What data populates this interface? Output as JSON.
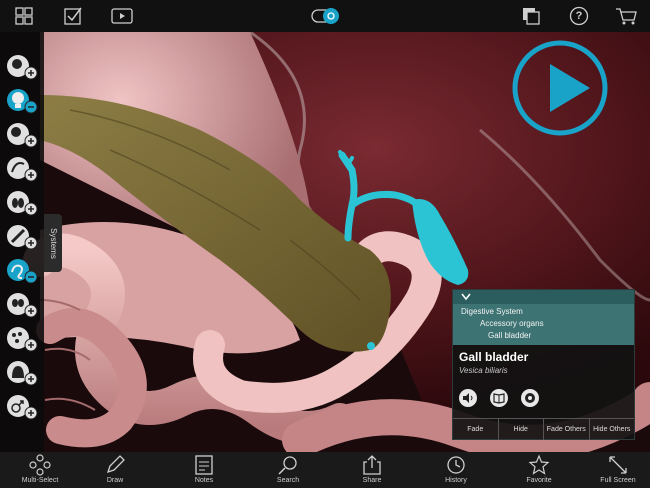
{
  "topbar": {
    "icons": [
      "grid-icon",
      "checklist-icon",
      "video-icon",
      "camera-toggle-icon",
      "layers-icon",
      "help-icon",
      "cart-icon"
    ],
    "help_label": "?"
  },
  "sidebar": {
    "tab_label": "Systems",
    "buttons": [
      "skeletal",
      "muscular",
      "cardiovascular",
      "nervous",
      "respiratory",
      "lymphatic",
      "digestive",
      "urinary",
      "endocrine",
      "integumentary",
      "reproductive"
    ],
    "active_index": 6
  },
  "info_panel": {
    "breadcrumbs": [
      "Digestive System",
      "Accessory organs",
      "Gall bladder"
    ],
    "title": "Gall bladder",
    "latin": "Vesica biliaris",
    "actions": [
      "Fade",
      "Hide",
      "Fade Others",
      "Hide Others"
    ],
    "icons": [
      "speaker-icon",
      "book-icon",
      "quiz-icon"
    ]
  },
  "bottombar": {
    "items": [
      {
        "label": "Multi-Select",
        "icon": "multi-select-icon"
      },
      {
        "label": "Draw",
        "icon": "pencil-icon"
      },
      {
        "label": "Notes",
        "icon": "notes-icon"
      },
      {
        "label": "Search",
        "icon": "search-icon"
      },
      {
        "label": "Share",
        "icon": "share-icon"
      },
      {
        "label": "History",
        "icon": "history-icon"
      },
      {
        "label": "Favorite",
        "icon": "star-icon"
      },
      {
        "label": "Full Screen",
        "icon": "fullscreen-icon"
      }
    ]
  },
  "colors": {
    "accent": "#1aa3c9",
    "gallbladder": "#2bc4d4",
    "pancreas": "#7a6a35",
    "intestine": "#e8b1b0",
    "liver": "#5a1a1f",
    "panel_header": "#2c5d5e"
  }
}
